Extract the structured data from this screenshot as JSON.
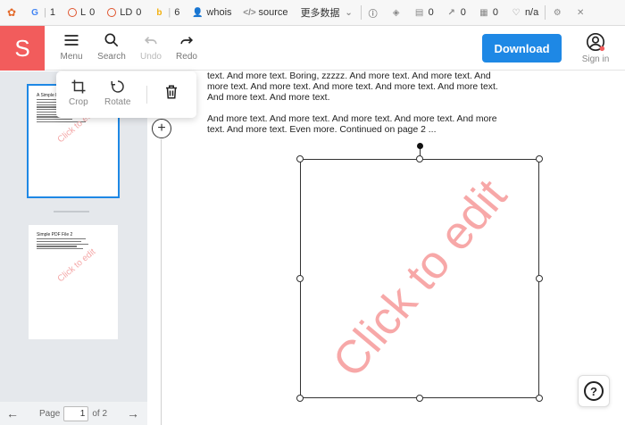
{
  "seo_bar": {
    "google": "1",
    "links_label": "L",
    "links_value": "0",
    "linking_domains_label": "LD",
    "linking_domains_value": "0",
    "bing_value": "6",
    "whois_label": "whois",
    "source_label": "source",
    "more_data_label": "更多数据",
    "social_a": "0",
    "social_b": "0",
    "social_c": "0",
    "rank_value": "n/a"
  },
  "header": {
    "logo": "S",
    "tools": [
      {
        "label": "Menu",
        "icon": "hamburger-menu-icon"
      },
      {
        "label": "Search",
        "icon": "search-icon"
      },
      {
        "label": "Undo",
        "icon": "undo-icon"
      },
      {
        "label": "Redo",
        "icon": "redo-icon"
      }
    ],
    "download_label": "Download",
    "signin_label": "Sign in"
  },
  "float_tools": {
    "crop_label": "Crop",
    "rotate_label": "Rotate"
  },
  "sidebar": {
    "pages": [
      {
        "title": "A Simple P",
        "watermark": "Click to edit"
      },
      {
        "title": "Simple PDF File 2",
        "watermark": "Click to edit"
      }
    ],
    "pager": {
      "page_label": "Page",
      "current_page": "1",
      "total_label": "of 2"
    }
  },
  "document": {
    "paragraph_1": "text. And more text. Boring, zzzzz. And more text. And more text. And more text. And more text. And more text. And more text. And more text. And more text. And more text.",
    "paragraph_2": "And more text. And more text. And more text. And more text. And more text. And more text. Even more. Continued on page 2 ...",
    "image_watermark": "Click to edit"
  },
  "help": {
    "label": "?"
  },
  "colors": {
    "accent": "#1e88e5",
    "brand": "#f25c5c",
    "watermark": "#f7a8a8"
  }
}
